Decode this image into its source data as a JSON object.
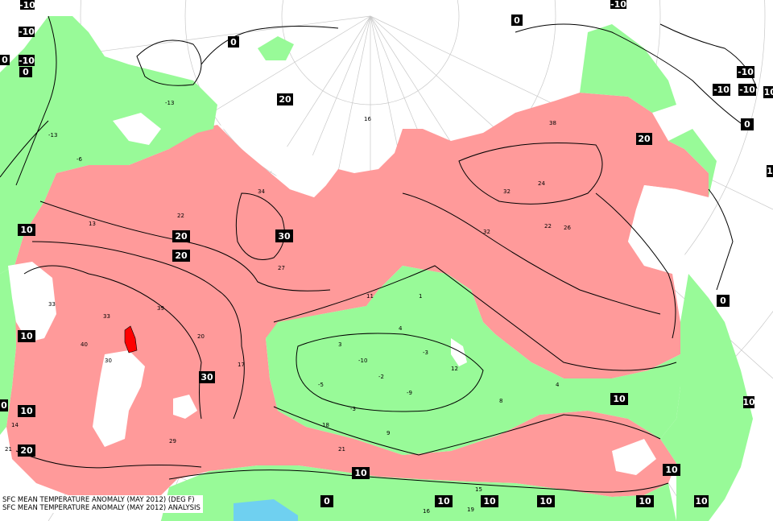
{
  "map": {
    "colors": {
      "warm": "#ff9a9a",
      "cold": "#98fa98",
      "hot_spot": "#ff0000",
      "background": "#ffffff",
      "sea": "#6fd0f0",
      "contour": "#000000",
      "graticule": "#c8c8c8"
    },
    "legend": {
      "line1": "SFC MEAN TEMPERATURE ANOMALY (MAY 2012) (DEG F)",
      "line2": "SFC MEAN TEMPERATURE ANOMALY (MAY 2012) ANALYSIS"
    },
    "contour_labels": [
      {
        "text": "-10"
      },
      {
        "text": "-10"
      },
      {
        "text": "-10"
      },
      {
        "text": "0"
      },
      {
        "text": "0"
      },
      {
        "text": "0"
      },
      {
        "text": "-10"
      },
      {
        "text": "0"
      },
      {
        "text": "-10"
      },
      {
        "text": "-10"
      },
      {
        "text": "-10"
      },
      {
        "text": "-10"
      },
      {
        "text": "0"
      },
      {
        "text": "20"
      },
      {
        "text": "20"
      },
      {
        "text": "20"
      },
      {
        "text": "20"
      },
      {
        "text": "30"
      },
      {
        "text": "10"
      },
      {
        "text": "10"
      },
      {
        "text": "30"
      },
      {
        "text": "10"
      },
      {
        "text": "0"
      },
      {
        "text": "10"
      },
      {
        "text": "20"
      },
      {
        "text": "10"
      },
      {
        "text": "0"
      },
      {
        "text": "10"
      },
      {
        "text": "10"
      },
      {
        "text": "10"
      },
      {
        "text": "10"
      },
      {
        "text": "10"
      },
      {
        "text": "0"
      },
      {
        "text": "10"
      },
      {
        "text": "10"
      },
      {
        "text": "1"
      }
    ],
    "station_values": [
      "21",
      "14",
      "-13",
      "16",
      "13",
      "22",
      "34",
      "33",
      "40",
      "39",
      "30",
      "29",
      "32",
      "38",
      "24",
      "32",
      "26",
      "22",
      "-5",
      "1",
      "4",
      "-2",
      "-10",
      "3",
      "-3",
      "11",
      "8",
      "-3",
      "4",
      "-13",
      "-6",
      "12",
      "19",
      "16",
      "15",
      "33",
      "20",
      "17",
      "21",
      "18",
      "9",
      "27",
      "-9"
    ]
  }
}
